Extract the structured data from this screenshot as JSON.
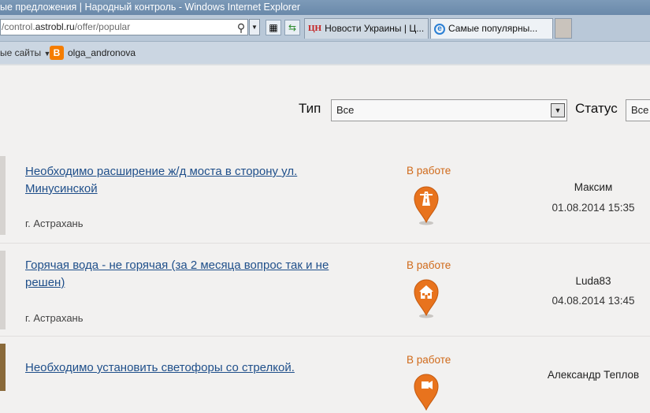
{
  "window": {
    "title": "ые предложения | Народный контроль - Windows Internet Explorer"
  },
  "address_bar": {
    "url_prefix": "/control.",
    "url_host": "astrobl.ru",
    "url_path": "/offer/popular"
  },
  "tabs": [
    {
      "label": "Новости Украины | Ц...",
      "favicon": "ЦН"
    },
    {
      "label": "Самые популярны...",
      "favicon": "e"
    }
  ],
  "favorites_bar": {
    "suggested_label": "ые сайты",
    "blog_label": "olga_andronova"
  },
  "filters": {
    "type_label": "Тип",
    "type_value": "Все",
    "status_label": "Статус",
    "status_value": "Все"
  },
  "offers": [
    {
      "title": "Необходимо расширение ж/д моста в сторону ул. Минусинской",
      "city": "г. Астрахань",
      "status": "В работе",
      "icon": "road-icon",
      "author": "Максим",
      "date": "01.08.2014 15:35"
    },
    {
      "title": "Горячая вода - не горячая (за 2 месяца вопрос так и не решен)",
      "city": "г. Астрахань",
      "status": "В работе",
      "icon": "house-icon",
      "author": "Luda83",
      "date": "04.08.2014 13:45"
    },
    {
      "title": "Необходимо установить светофоры со стрелкой.",
      "city": "",
      "status": "В работе",
      "icon": "car-icon",
      "author": "Александр Теплов",
      "date": ""
    }
  ],
  "colors": {
    "status": "#d06a1a",
    "pin": "#e8731d",
    "link": "#1f4f8a"
  }
}
